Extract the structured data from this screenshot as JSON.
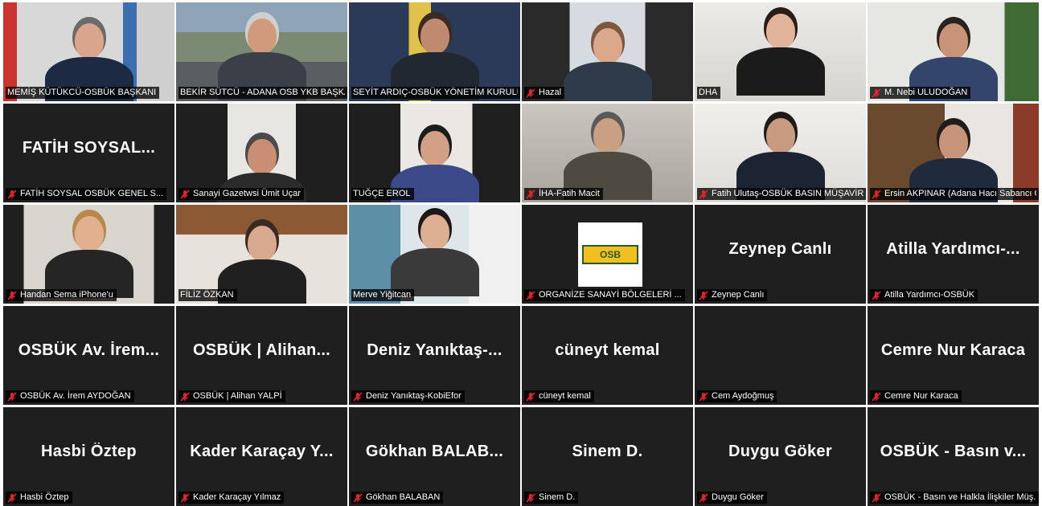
{
  "meeting": {
    "tiles": [
      {
        "label": "MEMİŞ KÜTÜKCÜ-OSBÜK BAŞKANI",
        "muted": false,
        "active": true,
        "mode": "video",
        "scene": "office-flag"
      },
      {
        "label": "BEKİR SÜTCÜ - ADANA OSB YKB BAŞKANI",
        "muted": false,
        "mode": "video",
        "scene": "city"
      },
      {
        "label": "SEYİT ARDIÇ-OSBÜK YÖNETİM KURULU ...",
        "muted": false,
        "mode": "video",
        "scene": "banner"
      },
      {
        "label": "Hazal",
        "muted": true,
        "mode": "video",
        "scene": "room-light"
      },
      {
        "label": "DHA",
        "muted": false,
        "mode": "video",
        "scene": "room-white"
      },
      {
        "label": "M. Nebi ULUDOĞAN",
        "muted": true,
        "mode": "video",
        "scene": "room-plant"
      },
      {
        "label": "FATİH SOYSAL OSBÜK GENEL S...",
        "muted": true,
        "mode": "name",
        "name": "FATİH SOYSAL..."
      },
      {
        "label": "Sanayi Gazetwsi Ümit Uçar",
        "muted": true,
        "mode": "video",
        "scene": "small-window"
      },
      {
        "label": "TUĞÇE EROL",
        "muted": false,
        "mode": "video",
        "scene": "small-window-2"
      },
      {
        "label": "İHA-Fatih Macit",
        "muted": true,
        "mode": "video",
        "scene": "headset"
      },
      {
        "label": "Fatih Ulutaş-OSBÜK BASIN MÜŞAVİRİ",
        "muted": true,
        "mode": "video",
        "scene": "suit-white"
      },
      {
        "label": "Ersin AKPINAR (Adana Hacı Sabancı OSB...",
        "muted": true,
        "mode": "video",
        "scene": "office-wood"
      },
      {
        "label": "Handan Sema iPhone'u",
        "muted": true,
        "mode": "video",
        "scene": "desk-phone"
      },
      {
        "label": "FİLİZ ÖZKAN",
        "muted": false,
        "mode": "video",
        "scene": "painting"
      },
      {
        "label": "Merve Yiğitcan",
        "muted": false,
        "mode": "video",
        "scene": "art-close"
      },
      {
        "label": "ORGANİZE SANAYİ BÖLGELERİ ...",
        "muted": true,
        "mode": "logo",
        "logo": "OSB"
      },
      {
        "label": "Zeynep Canlı",
        "muted": true,
        "mode": "name",
        "name": "Zeynep Canlı"
      },
      {
        "label": "Atilla Yardımcı-OSBÜK",
        "muted": true,
        "mode": "name",
        "name": "Atilla Yardımcı-..."
      },
      {
        "label": "OSBÜK Av. İrem AYDOĞAN",
        "muted": true,
        "mode": "name",
        "name": "OSBÜK Av. İrem..."
      },
      {
        "label": "OSBÜK | Alihan YALPİ",
        "muted": true,
        "mode": "name",
        "name": "OSBÜK | Alihan..."
      },
      {
        "label": "Deniz Yanıktaş-KobiEfor",
        "muted": true,
        "mode": "name",
        "name": "Deniz Yanıktaş-..."
      },
      {
        "label": "cüneyt kemal",
        "muted": true,
        "mode": "name",
        "name": "cüneyt kemal"
      },
      {
        "label": "Cem Aydoğmuş",
        "muted": true,
        "mode": "blank",
        "name": ""
      },
      {
        "label": "Cemre Nur Karaca",
        "muted": true,
        "mode": "name",
        "name": "Cemre Nur Karaca"
      },
      {
        "label": "Hasbi Öztep",
        "muted": true,
        "mode": "name",
        "name": "Hasbi Öztep"
      },
      {
        "label": "Kader Karaçay Yılmaz",
        "muted": true,
        "mode": "name",
        "name": "Kader Karaçay Y..."
      },
      {
        "label": "Gökhan BALABAN",
        "muted": true,
        "mode": "name",
        "name": "Gökhan BALAB..."
      },
      {
        "label": "Sinem D.",
        "muted": true,
        "mode": "name",
        "name": "Sinem D."
      },
      {
        "label": "Duygu Göker",
        "muted": true,
        "mode": "name",
        "name": "Duygu Göker"
      },
      {
        "label": "OSBÜK - Basın ve Halkla İlişkiler Müş...",
        "muted": true,
        "mode": "name",
        "name": "OSBÜK - Basın v..."
      }
    ]
  },
  "colors": {
    "tile_bg": "#1f1f1f",
    "active_border": "#f5e14a",
    "mute_icon": "#e0232b",
    "label_bg": "#000000",
    "text": "#ffffff"
  }
}
